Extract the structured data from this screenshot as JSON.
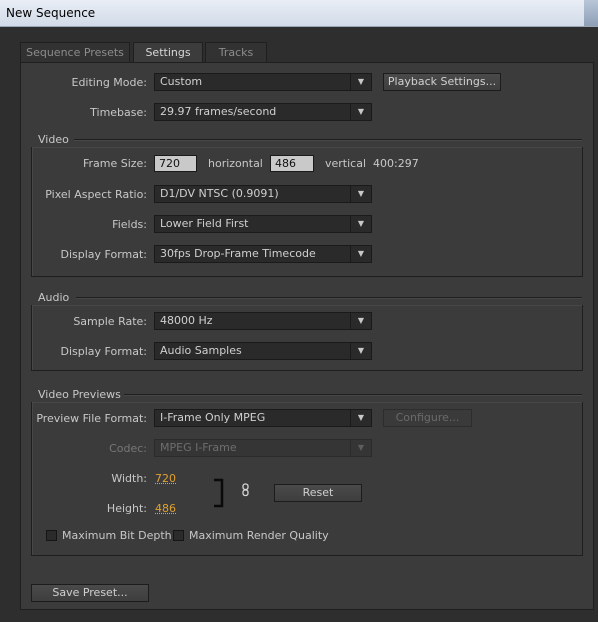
{
  "window": {
    "title": "New Sequence"
  },
  "tabs": [
    {
      "label": "Sequence Presets",
      "active": false
    },
    {
      "label": "Settings",
      "active": true
    },
    {
      "label": "Tracks",
      "active": false
    }
  ],
  "general": {
    "editing_mode_label": "Editing Mode:",
    "editing_mode_value": "Custom",
    "playback_settings_label": "Playback Settings...",
    "timebase_label": "Timebase:",
    "timebase_value": "29.97 frames/second"
  },
  "video": {
    "title": "Video",
    "frame_size_label": "Frame Size:",
    "frame_width": "720",
    "horizontal_label": "horizontal",
    "frame_height": "486",
    "vertical_label": "vertical",
    "aspect_ratio": "400:297",
    "pixel_aspect_label": "Pixel Aspect Ratio:",
    "pixel_aspect_value": "D1/DV NTSC (0.9091)",
    "fields_label": "Fields:",
    "fields_value": "Lower Field First",
    "display_format_label": "Display Format:",
    "display_format_value": "30fps Drop-Frame Timecode"
  },
  "audio": {
    "title": "Audio",
    "sample_rate_label": "Sample Rate:",
    "sample_rate_value": "48000 Hz",
    "display_format_label": "Display Format:",
    "display_format_value": "Audio Samples"
  },
  "previews": {
    "title": "Video Previews",
    "file_format_label": "Preview File Format:",
    "file_format_value": "I-Frame Only MPEG",
    "configure_label": "Configure...",
    "codec_label": "Codec:",
    "codec_value": "MPEG I-Frame",
    "width_label": "Width:",
    "width_value": "720",
    "height_label": "Height:",
    "height_value": "486",
    "reset_label": "Reset",
    "max_bit_depth_label": "Maximum Bit Depth",
    "max_bit_depth_checked": false,
    "max_render_quality_label": "Maximum Render Quality",
    "max_render_quality_checked": false
  },
  "footer": {
    "save_preset_label": "Save Preset..."
  },
  "icons": {
    "dropdown": "chevron-down-icon",
    "link": "chain-link-icon"
  },
  "colors": {
    "accent_value": "#e0a030",
    "panel": "#3b3b3b",
    "background": "#2e2e2e"
  }
}
